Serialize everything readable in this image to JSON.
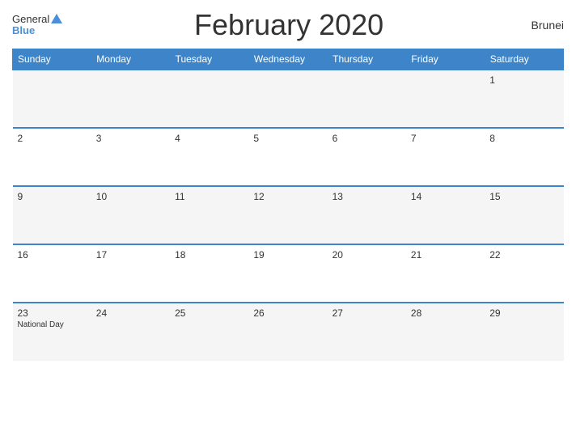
{
  "header": {
    "logo_general": "General",
    "logo_blue": "Blue",
    "title": "February 2020",
    "country": "Brunei"
  },
  "days_of_week": [
    "Sunday",
    "Monday",
    "Tuesday",
    "Wednesday",
    "Thursday",
    "Friday",
    "Saturday"
  ],
  "weeks": [
    [
      {
        "day": "",
        "holiday": ""
      },
      {
        "day": "",
        "holiday": ""
      },
      {
        "day": "",
        "holiday": ""
      },
      {
        "day": "",
        "holiday": ""
      },
      {
        "day": "",
        "holiday": ""
      },
      {
        "day": "",
        "holiday": ""
      },
      {
        "day": "1",
        "holiday": ""
      }
    ],
    [
      {
        "day": "2",
        "holiday": ""
      },
      {
        "day": "3",
        "holiday": ""
      },
      {
        "day": "4",
        "holiday": ""
      },
      {
        "day": "5",
        "holiday": ""
      },
      {
        "day": "6",
        "holiday": ""
      },
      {
        "day": "7",
        "holiday": ""
      },
      {
        "day": "8",
        "holiday": ""
      }
    ],
    [
      {
        "day": "9",
        "holiday": ""
      },
      {
        "day": "10",
        "holiday": ""
      },
      {
        "day": "11",
        "holiday": ""
      },
      {
        "day": "12",
        "holiday": ""
      },
      {
        "day": "13",
        "holiday": ""
      },
      {
        "day": "14",
        "holiday": ""
      },
      {
        "day": "15",
        "holiday": ""
      }
    ],
    [
      {
        "day": "16",
        "holiday": ""
      },
      {
        "day": "17",
        "holiday": ""
      },
      {
        "day": "18",
        "holiday": ""
      },
      {
        "day": "19",
        "holiday": ""
      },
      {
        "day": "20",
        "holiday": ""
      },
      {
        "day": "21",
        "holiday": ""
      },
      {
        "day": "22",
        "holiday": ""
      }
    ],
    [
      {
        "day": "23",
        "holiday": "National Day"
      },
      {
        "day": "24",
        "holiday": ""
      },
      {
        "day": "25",
        "holiday": ""
      },
      {
        "day": "26",
        "holiday": ""
      },
      {
        "day": "27",
        "holiday": ""
      },
      {
        "day": "28",
        "holiday": ""
      },
      {
        "day": "29",
        "holiday": ""
      }
    ]
  ]
}
